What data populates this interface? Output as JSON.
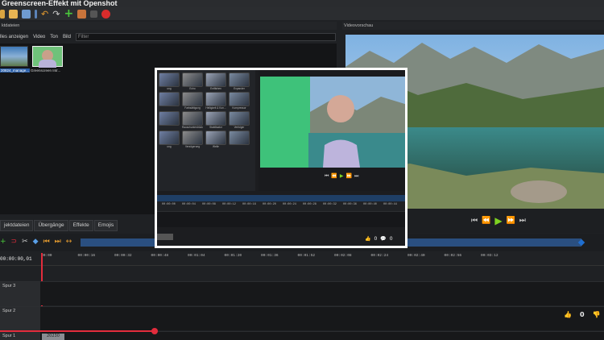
{
  "window": {
    "title": "Greenscreen-Effekt mit Openshot"
  },
  "panels": {
    "files_header": "ktdateien",
    "preview_header": "Videovorschau"
  },
  "filter": {
    "tabs": [
      "lles anzeigen",
      "Video",
      "Ton",
      "Bild"
    ],
    "placeholder": "Filter"
  },
  "clips": [
    {
      "label": "20824_manage..."
    },
    {
      "label": "Greenscreen Intr..."
    }
  ],
  "bottom_tabs": [
    "jektdateien",
    "Übergänge",
    "Effekte",
    "Emojis"
  ],
  "timeline": {
    "timecode": "00:00:00,01",
    "ruler_ticks": [
      "00:00",
      "00:00:16",
      "00:00:32",
      "00:00:48",
      "00:01:04",
      "00:01:20",
      "00:01:36",
      "00:01:52",
      "00:02:08",
      "00:02:24",
      "00:02:40",
      "00:02:56",
      "00:03:12"
    ],
    "tracks": [
      {
        "label": "Spur 3"
      },
      {
        "label": "Spur 2"
      },
      {
        "label": "Spur 1"
      }
    ],
    "clip_label": "20230"
  },
  "overlay": {
    "effects": [
      "ung",
      "Echo",
      "Entfärben",
      "Expander",
      "",
      "Farbsättigung",
      "Helligkeit & Kon...",
      "Kompressor",
      "",
      "Rauschunterdrückung",
      "Stabilisator",
      "Verfolger",
      "ung",
      "Verzögerung",
      "Welle",
      ""
    ],
    "ruler_ticks": [
      "00:00:00",
      "00:00:04",
      "00:00:08",
      "00:00:12",
      "00:00:16",
      "00:00:20",
      "00:00:24",
      "00:00:28",
      "00:00:32",
      "00:00:36",
      "00:00:40",
      "00:00:44"
    ],
    "likes": "0",
    "comments": "0"
  },
  "reactions": {
    "likes": "0"
  },
  "colors": {
    "accent": "#1f6fd1",
    "playhead": "#e22c3c",
    "play": "#7ed321"
  }
}
